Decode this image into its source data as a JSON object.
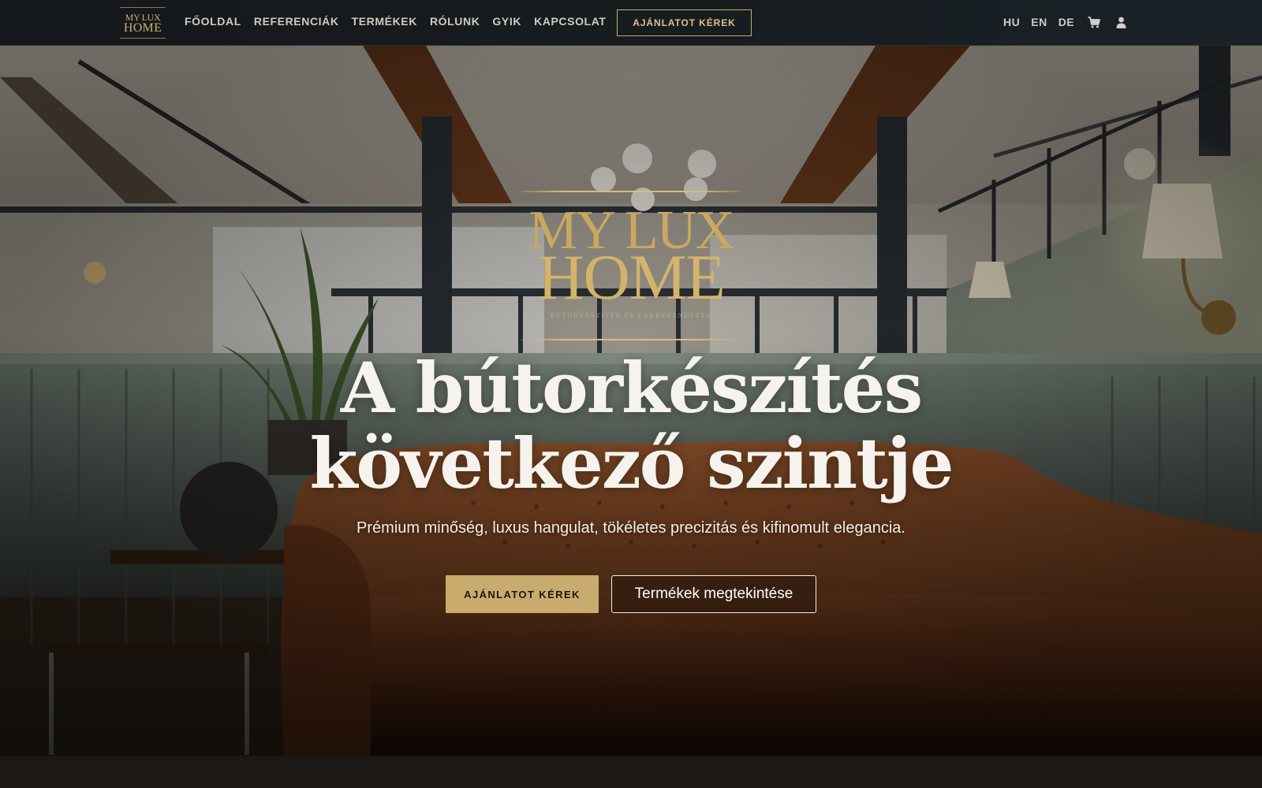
{
  "nav": {
    "logo": {
      "line1": "MY LUX",
      "line2": "HOME"
    },
    "links": [
      "FŐOLDAL",
      "REFERENCIÁK",
      "TERMÉKEK",
      "RÓLUNK",
      "GYIK",
      "KAPCSOLAT"
    ],
    "cta_label": "AJÁNLATOT KÉREK",
    "languages": [
      "HU",
      "EN",
      "DE"
    ],
    "icons": {
      "cart": "cart-icon",
      "account": "user-icon"
    }
  },
  "hero": {
    "brand": {
      "line1": "MY LUX",
      "line2": "HOME",
      "tagline": "BÚTORKÉSZÍTÉS ÉS LAKBERENDEZÉS"
    },
    "title_line1": "A bútorkészítés",
    "title_line2": "következő szintje",
    "subtitle": "Prémium minőség, luxus hangulat, tökéletes precizitás és kifinomult elegancia.",
    "primary_button": "AJÁNLATOT KÉREK",
    "secondary_button": "Termékek megtekintése"
  },
  "colors": {
    "accent_gold": "#c9ab6d",
    "nav_background": "#15181a",
    "text_light": "#f6f3ee"
  }
}
